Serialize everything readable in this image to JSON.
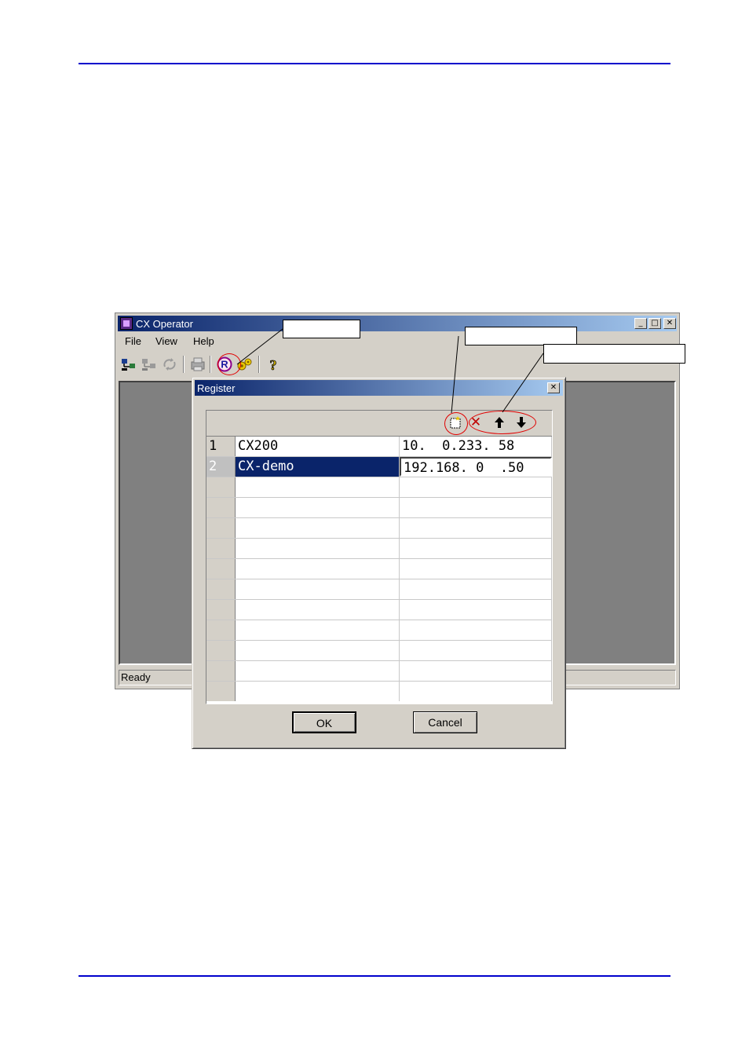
{
  "window": {
    "title": "CX Operator",
    "controls": {
      "minimize": "_",
      "maximize": "□",
      "close": "✕"
    },
    "menu": [
      "File",
      "View",
      "Help"
    ],
    "toolbar_icons": [
      "connect-icon",
      "disconnect-icon",
      "refresh-icon",
      "print-icon",
      "register-icon",
      "settings-icon",
      "help-icon"
    ],
    "register_glyph": "R",
    "help_glyph": "?",
    "status": "Ready"
  },
  "dialog": {
    "title": "Register",
    "close": "✕",
    "grid_tools": {
      "add": "▢",
      "delete": "✕",
      "up": "🡅",
      "down": "🡇"
    },
    "rows": [
      {
        "num": "1",
        "name": "CX200",
        "ip": "10.  0.233. 58"
      },
      {
        "num": "2",
        "name": "CX-demo",
        "ip": "192.168. 0  .50"
      },
      {
        "num": "",
        "name": "",
        "ip": ""
      },
      {
        "num": "",
        "name": "",
        "ip": ""
      },
      {
        "num": "",
        "name": "",
        "ip": ""
      },
      {
        "num": "",
        "name": "",
        "ip": ""
      },
      {
        "num": "",
        "name": "",
        "ip": ""
      },
      {
        "num": "",
        "name": "",
        "ip": ""
      },
      {
        "num": "",
        "name": "",
        "ip": ""
      },
      {
        "num": "",
        "name": "",
        "ip": ""
      },
      {
        "num": "",
        "name": "",
        "ip": ""
      },
      {
        "num": "",
        "name": "",
        "ip": ""
      },
      {
        "num": "",
        "name": "",
        "ip": ""
      }
    ],
    "ok_label": "OK",
    "cancel_label": "Cancel"
  },
  "colors": {
    "rule": "#0000cc",
    "title_bar": "#0a246a",
    "annotation": "#e00000"
  }
}
